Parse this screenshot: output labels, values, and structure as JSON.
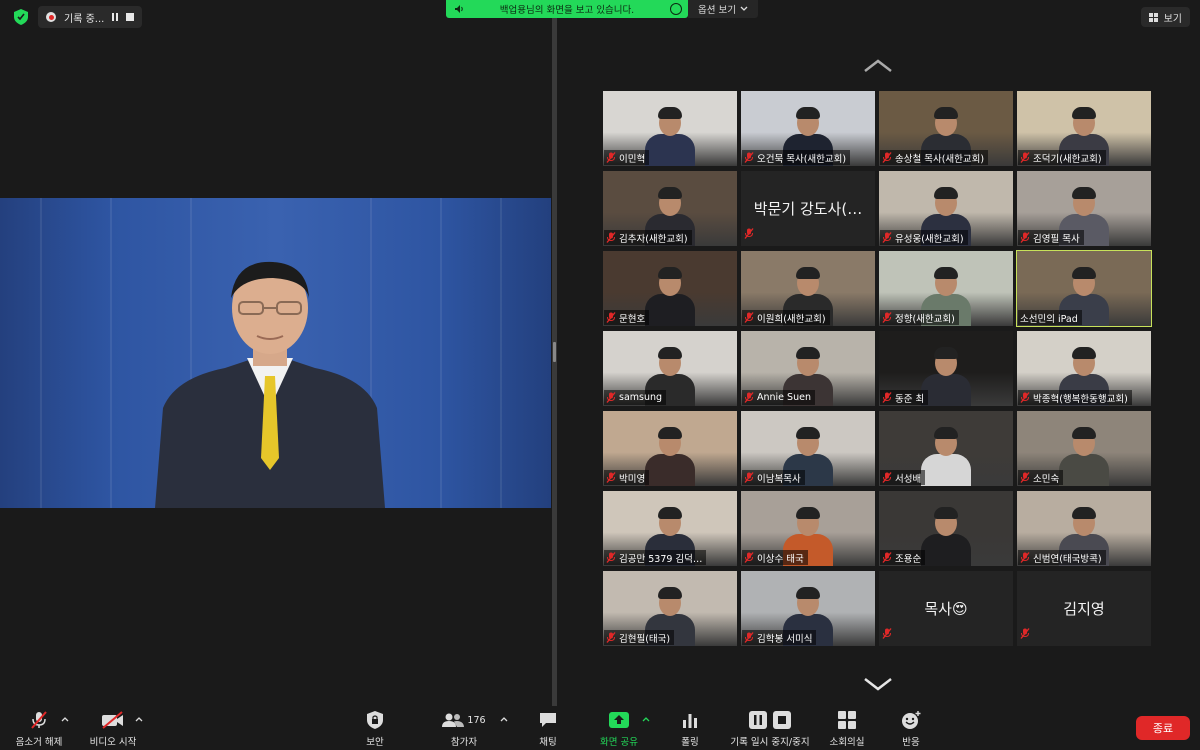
{
  "recording": {
    "label": "기록 중..."
  },
  "share_banner": {
    "text": "백업용님의 화면을 보고 있습니다.",
    "view_options": "옵션 보기"
  },
  "view_button": {
    "label": "보기"
  },
  "accent": {
    "green": "#23d959",
    "end": "#e02828",
    "active_outline": "#c8e25a"
  },
  "participants": [
    {
      "name": "이민혁",
      "muted": true,
      "video": true
    },
    {
      "name": "오건묵 목사(새한교회)",
      "muted": true,
      "video": true
    },
    {
      "name": "송상철 목사(새한교회)",
      "muted": true,
      "video": true
    },
    {
      "name": "조덕기(새한교회)",
      "muted": true,
      "video": true
    },
    {
      "name": "김추자(새한교회)",
      "muted": true,
      "video": true
    },
    {
      "name": "박문기 강도사(…",
      "muted": true,
      "video": false
    },
    {
      "name": "유성웅(새한교회)",
      "muted": true,
      "video": true
    },
    {
      "name": "김영필 목사",
      "muted": true,
      "video": true
    },
    {
      "name": "문현호",
      "muted": true,
      "video": true
    },
    {
      "name": "이원희(새한교회)",
      "muted": true,
      "video": true
    },
    {
      "name": "정향(새한교회)",
      "muted": true,
      "video": true
    },
    {
      "name": "소선민의 iPad",
      "muted": false,
      "video": true,
      "active": true
    },
    {
      "name": "samsung",
      "muted": true,
      "video": true
    },
    {
      "name": "Annie Suen",
      "muted": true,
      "video": true
    },
    {
      "name": "동준 최",
      "muted": true,
      "video": true
    },
    {
      "name": "박종혁(행복한동행교회)",
      "muted": true,
      "video": true
    },
    {
      "name": "박미영",
      "muted": true,
      "video": true
    },
    {
      "name": "이남복목사",
      "muted": true,
      "video": true
    },
    {
      "name": "서성배",
      "muted": true,
      "video": true
    },
    {
      "name": "소민숙",
      "muted": true,
      "video": true
    },
    {
      "name": "김공만 5379 김덕…",
      "muted": true,
      "video": true
    },
    {
      "name": "이상수 태국",
      "muted": true,
      "video": true
    },
    {
      "name": "조용순",
      "muted": true,
      "video": true
    },
    {
      "name": "신범연(태국방콕)",
      "muted": true,
      "video": true
    },
    {
      "name": "김현필(태국)",
      "muted": true,
      "video": true
    },
    {
      "name": "김학봉 서미식",
      "muted": true,
      "video": true
    },
    {
      "name": "목사😍",
      "muted": true,
      "video": false
    },
    {
      "name": "김지영",
      "muted": true,
      "video": false
    }
  ],
  "toolbar": {
    "unmute": "음소거 해제",
    "start_video": "비디오 시작",
    "security": "보안",
    "participants": "참가자",
    "participants_count": "176",
    "chat": "채팅",
    "share": "화면 공유",
    "polls": "폴링",
    "pause_recording": "기록 일시 중지/중지",
    "breakout": "소회의실",
    "reactions": "반응",
    "end": "종료"
  }
}
